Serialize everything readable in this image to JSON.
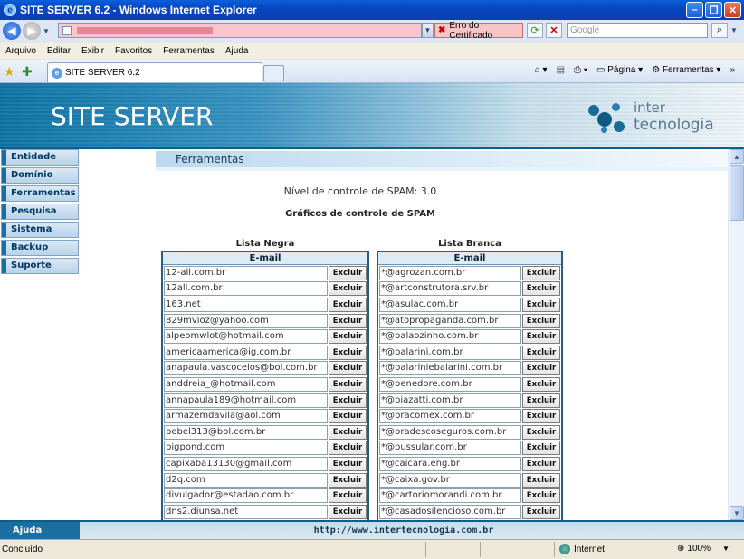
{
  "window": {
    "title": "SITE SERVER 6.2 - Windows Internet Explorer"
  },
  "addressbar": {
    "cert_error": "Erro do Certificado",
    "search_placeholder": "Google"
  },
  "menu": [
    "Arquivo",
    "Editar",
    "Exibir",
    "Favoritos",
    "Ferramentas",
    "Ajuda"
  ],
  "tab": {
    "label": "SITE SERVER 6.2"
  },
  "commandbar": {
    "page": "Página",
    "tools": "Ferramentas"
  },
  "banner": {
    "title": "SITE SERVER",
    "logo_line1": "inter",
    "logo_line2": "tecnologia"
  },
  "sidebar": {
    "items": [
      "Entidade",
      "Domínio",
      "Ferramentas",
      "Pesquisa",
      "Sistema",
      "Backup",
      "Suporte"
    ]
  },
  "content": {
    "section_title": "Ferramentas",
    "spam_level": "Nível de controle de SPAM: 3.0",
    "graphs_title": "Gráficos de controle de SPAM",
    "delete_label": "Excluir",
    "email_header": "E-mail",
    "blacklist": {
      "title": "Lista Negra",
      "entries": [
        "12-all.com.br",
        "12all.com.br",
        "163.net",
        "829mvioz@yahoo.com",
        "alpeomwlot@hotmail.com",
        "americaamerica@ig.com.br",
        "anapaula.vascocelos@bol.com.br",
        "anddreia_@hotmail.com",
        "annapaula189@hotmail.com",
        "armazemdavila@aol.com",
        "bebel313@bol.com.br",
        "bigpond.com",
        "capixaba13130@gmail.com",
        "d2q.com",
        "divulgador@estadao.com.br",
        "dns2.diunsa.net"
      ]
    },
    "whitelist": {
      "title": "Lista Branca",
      "entries": [
        "*@agrozan.com.br",
        "*@artconstrutora.srv.br",
        "*@asulac.com.br",
        "*@atopropaganda.com.br",
        "*@balaozinho.com.br",
        "*@balarini.com.br",
        "*@balariniebalarini.com.br",
        "*@benedore.com.br",
        "*@biazatti.com.br",
        "*@bracomex.com.br",
        "*@bradescoseguros.com.br",
        "*@bussular.com.br",
        "*@caicara.eng.br",
        "*@caixa.gov.br",
        "*@cartoriomorandi.com.br",
        "*@casadosilencioso.com.br"
      ]
    }
  },
  "footer": {
    "help": "Ajuda",
    "url": "http://www.intertecnologia.com.br"
  },
  "statusbar": {
    "status": "Concluído",
    "zone": "Internet",
    "zoom": "100%"
  }
}
